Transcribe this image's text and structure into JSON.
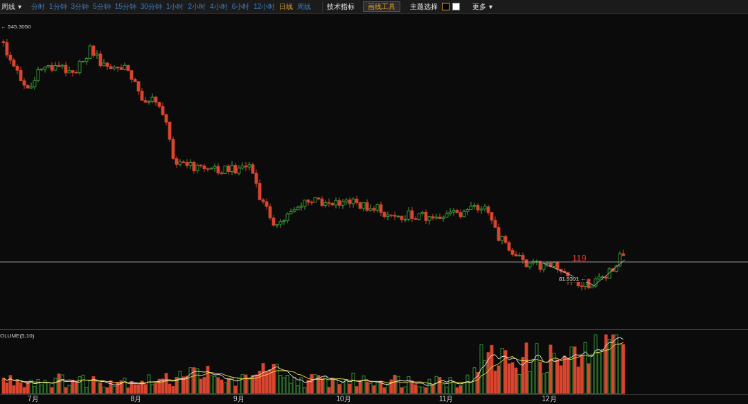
{
  "toolbar": {
    "period_menu": {
      "label": "周线",
      "caret": "▾"
    },
    "periods": [
      {
        "label": "分时",
        "selected": false
      },
      {
        "label": "1分钟",
        "selected": false
      },
      {
        "label": "3分钟",
        "selected": false
      },
      {
        "label": "5分钟",
        "selected": false
      },
      {
        "label": "15分钟",
        "selected": false
      },
      {
        "label": "30分钟",
        "selected": false
      },
      {
        "label": "1小时",
        "selected": false
      },
      {
        "label": "2小时",
        "selected": false
      },
      {
        "label": "4小时",
        "selected": false
      },
      {
        "label": "6小时",
        "selected": false
      },
      {
        "label": "12小时",
        "selected": false
      },
      {
        "label": "日线",
        "selected": true
      },
      {
        "label": "周线",
        "selected": false
      }
    ],
    "indicator_button": "技术指标",
    "drawing_tools": {
      "label": "画线工具",
      "active": true
    },
    "theme": {
      "label": "主题选择",
      "swatches": [
        {
          "color": "#000000",
          "selected": true
        },
        {
          "color": "#ffffff",
          "selected": false
        }
      ]
    },
    "more": {
      "label": "更多",
      "caret": "▾"
    }
  },
  "price_chart": {
    "max_label": "← 545.3050",
    "min_label": "81.9391 ←",
    "annotation": "119"
  },
  "volume_panel": {
    "label": "OLUME(5,10)"
  },
  "x_axis": [
    "7月",
    "8月",
    "9月",
    "10月",
    "11月",
    "12月"
  ]
}
